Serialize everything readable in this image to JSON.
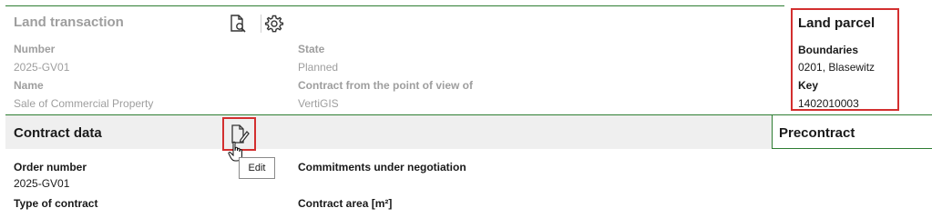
{
  "land_transaction": {
    "title": "Land transaction",
    "number_label": "Number",
    "number_value": "2025-GV01",
    "name_label": "Name",
    "name_value": "Sale of Commercial Property",
    "state_label": "State",
    "state_value": "Planned",
    "contract_pov_label": "Contract from the point of view of",
    "contract_pov_value": "VertiGIS",
    "icons": [
      "document-search-icon",
      "gear-icon"
    ]
  },
  "land_parcel": {
    "title": "Land parcel",
    "boundaries_label": "Boundaries",
    "boundaries_value": "0201, Blasewitz",
    "key_label": "Key",
    "key_value": "1402010003"
  },
  "contract_data": {
    "title": "Contract data",
    "edit_tooltip": "Edit",
    "order_number_label": "Order number",
    "order_number_value": "2025-GV01",
    "type_of_contract_label": "Type of contract",
    "commitments_label": "Commitments under negotiation",
    "contract_area_label": "Contract area [m²]"
  },
  "precontract": {
    "title": "Precontract"
  },
  "colors": {
    "accent_green": "#2e7d32",
    "highlight_red": "#d32f2f",
    "muted_text": "#9e9e9e"
  }
}
